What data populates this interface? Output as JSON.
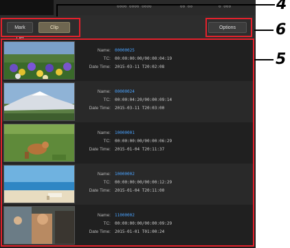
{
  "topbar": {
    "status_left": "0000 0000 0000",
    "status_mid": "00 00",
    "status_right": "0 000"
  },
  "toolbar": {
    "btn_left": "Mark List",
    "btn_left_active": "Clip",
    "btn_right": "Options"
  },
  "labels": {
    "name": "Name:",
    "tc": "TC:",
    "date": "Date Time:"
  },
  "clips": [
    {
      "name": "00000025",
      "tc": "00:00:00:00/00:00:04:19",
      "date": "2015-03-11 T20:02:08"
    },
    {
      "name": "00000024",
      "tc": "00:00:04:20/00:00:09:14",
      "date": "2015-03-11 T20:03:00"
    },
    {
      "name": "10000001",
      "tc": "00:00:00:00/00:00:06:29",
      "date": "2015-01-04 T20:11:37"
    },
    {
      "name": "10000002",
      "tc": "00:00:00:00/00:00:12:29",
      "date": "2015-01-04 T20:11:00"
    },
    {
      "name": "11000002",
      "tc": "00:00:00:00/00:00:09:29",
      "date": "2015-01-01 T01:00:24"
    }
  ],
  "callouts": {
    "top": "4",
    "middle": "6",
    "list": "5"
  },
  "colors": {
    "highlight": "#e5212c",
    "clip_name": "#4aa3ff"
  }
}
